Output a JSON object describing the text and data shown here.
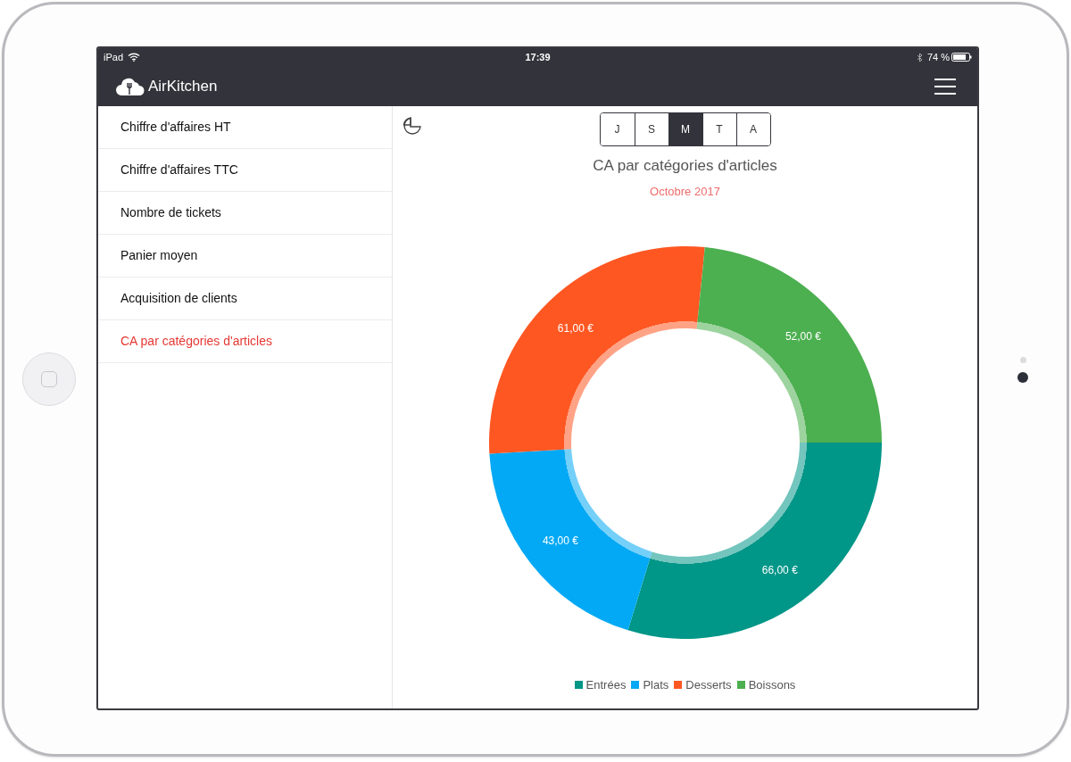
{
  "status_bar": {
    "device": "iPad",
    "time": "17:39",
    "battery": "74 %"
  },
  "app_bar": {
    "title": "AirKitchen"
  },
  "sidebar": {
    "items": [
      {
        "label": "Chiffre d'affaires HT",
        "selected": false
      },
      {
        "label": "Chiffre d'affaires TTC",
        "selected": false
      },
      {
        "label": "Nombre de tickets",
        "selected": false
      },
      {
        "label": "Panier moyen",
        "selected": false
      },
      {
        "label": "Acquisition de clients",
        "selected": false
      },
      {
        "label": "CA par catégories d'articles",
        "selected": true
      }
    ]
  },
  "period_tabs": [
    {
      "label": "J",
      "selected": false
    },
    {
      "label": "S",
      "selected": false
    },
    {
      "label": "M",
      "selected": true
    },
    {
      "label": "T",
      "selected": false
    },
    {
      "label": "A",
      "selected": false
    }
  ],
  "chart": {
    "title": "CA par catégories d'articles",
    "subtitle": "Octobre 2017",
    "chart_data": {
      "type": "donut",
      "categories": [
        "Entrées",
        "Plats",
        "Desserts",
        "Boissons"
      ],
      "values": [
        66,
        43,
        61,
        52
      ],
      "colors": [
        "#009688",
        "#03a9f4",
        "#ff5722",
        "#4caf50"
      ],
      "value_labels": [
        "66,00 €",
        "43,00 €",
        "61,00 €",
        "52,00 €"
      ]
    }
  }
}
